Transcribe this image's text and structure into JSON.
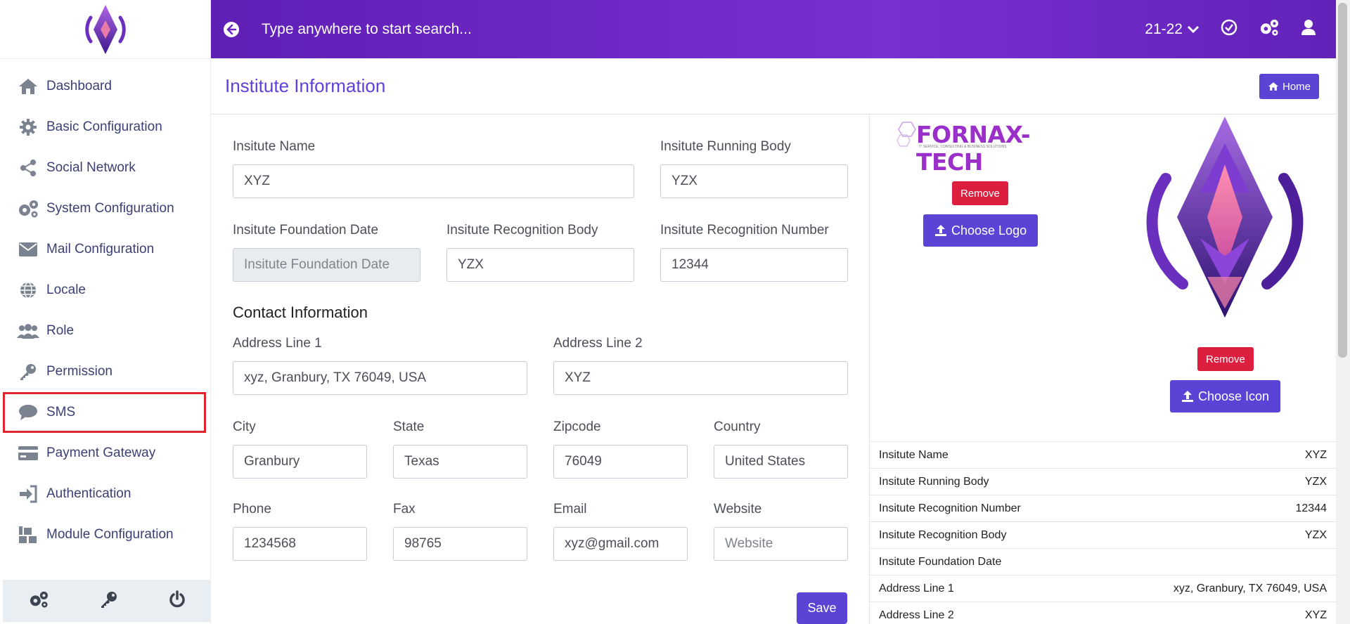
{
  "sidebar": {
    "items": [
      {
        "label": "Dashboard",
        "icon": "home-icon"
      },
      {
        "label": "Basic Configuration",
        "icon": "gear-icon"
      },
      {
        "label": "Social Network",
        "icon": "share-icon"
      },
      {
        "label": "System Configuration",
        "icon": "gears-icon"
      },
      {
        "label": "Mail Configuration",
        "icon": "envelope-icon"
      },
      {
        "label": "Locale",
        "icon": "globe-icon"
      },
      {
        "label": "Role",
        "icon": "users-icon"
      },
      {
        "label": "Permission",
        "icon": "key-icon"
      },
      {
        "label": "SMS",
        "icon": "chat-icon"
      },
      {
        "label": "Payment Gateway",
        "icon": "credit-card-icon"
      },
      {
        "label": "Authentication",
        "icon": "sign-in-icon"
      },
      {
        "label": "Module Configuration",
        "icon": "cubes-icon"
      }
    ],
    "active": "SMS"
  },
  "header": {
    "search_placeholder": "Type anywhere to start search...",
    "year": "21-22"
  },
  "page": {
    "title": "Institute Information",
    "home_label": "Home"
  },
  "form": {
    "institute_name": {
      "label": "Insitute Name",
      "value": "XYZ"
    },
    "running_body": {
      "label": "Insitute Running Body",
      "value": "YZX"
    },
    "foundation_date": {
      "label": "Insitute Foundation Date",
      "placeholder": "Insitute Foundation Date"
    },
    "recognition_body": {
      "label": "Insitute Recognition Body",
      "value": "YZX"
    },
    "recognition_number": {
      "label": "Insitute Recognition Number",
      "value": "12344"
    },
    "contact_heading": "Contact Information",
    "address1": {
      "label": "Address Line 1",
      "value": "xyz, Granbury, TX 76049, USA"
    },
    "address2": {
      "label": "Address Line 2",
      "value": "XYZ"
    },
    "city": {
      "label": "City",
      "value": "Granbury"
    },
    "state": {
      "label": "State",
      "value": "Texas"
    },
    "zipcode": {
      "label": "Zipcode",
      "value": "76049"
    },
    "country": {
      "label": "Country",
      "value": "United States"
    },
    "phone": {
      "label": "Phone",
      "value": "1234568"
    },
    "fax": {
      "label": "Fax",
      "value": "98765"
    },
    "email": {
      "label": "Email",
      "value": "xyz@gmail.com"
    },
    "website": {
      "label": "Website",
      "placeholder": "Website"
    },
    "save_label": "Save"
  },
  "media": {
    "logo_text": "FORNAX-TECH",
    "logo_tagline": "IT SERVICE, CONSULTING & BUSINESS SOLUTIONS",
    "remove_label": "Remove",
    "choose_logo_label": "Choose Logo",
    "choose_icon_label": "Choose Icon"
  },
  "info_table": [
    {
      "key": "Insitute Name",
      "value": "XYZ"
    },
    {
      "key": "Insitute Running Body",
      "value": "YZX"
    },
    {
      "key": "Insitute Recognition Number",
      "value": "12344"
    },
    {
      "key": "Insitute Recognition Body",
      "value": "YZX"
    },
    {
      "key": "Insitute Foundation Date",
      "value": ""
    },
    {
      "key": "Address Line 1",
      "value": "xyz, Granbury, TX 76049, USA"
    },
    {
      "key": "Address Line 2",
      "value": "XYZ"
    }
  ],
  "colors": {
    "accent": "#5a44d6",
    "header_gradient_start": "#5f1fb5",
    "danger": "#dc1f3f",
    "active_outline": "#e0242f"
  }
}
